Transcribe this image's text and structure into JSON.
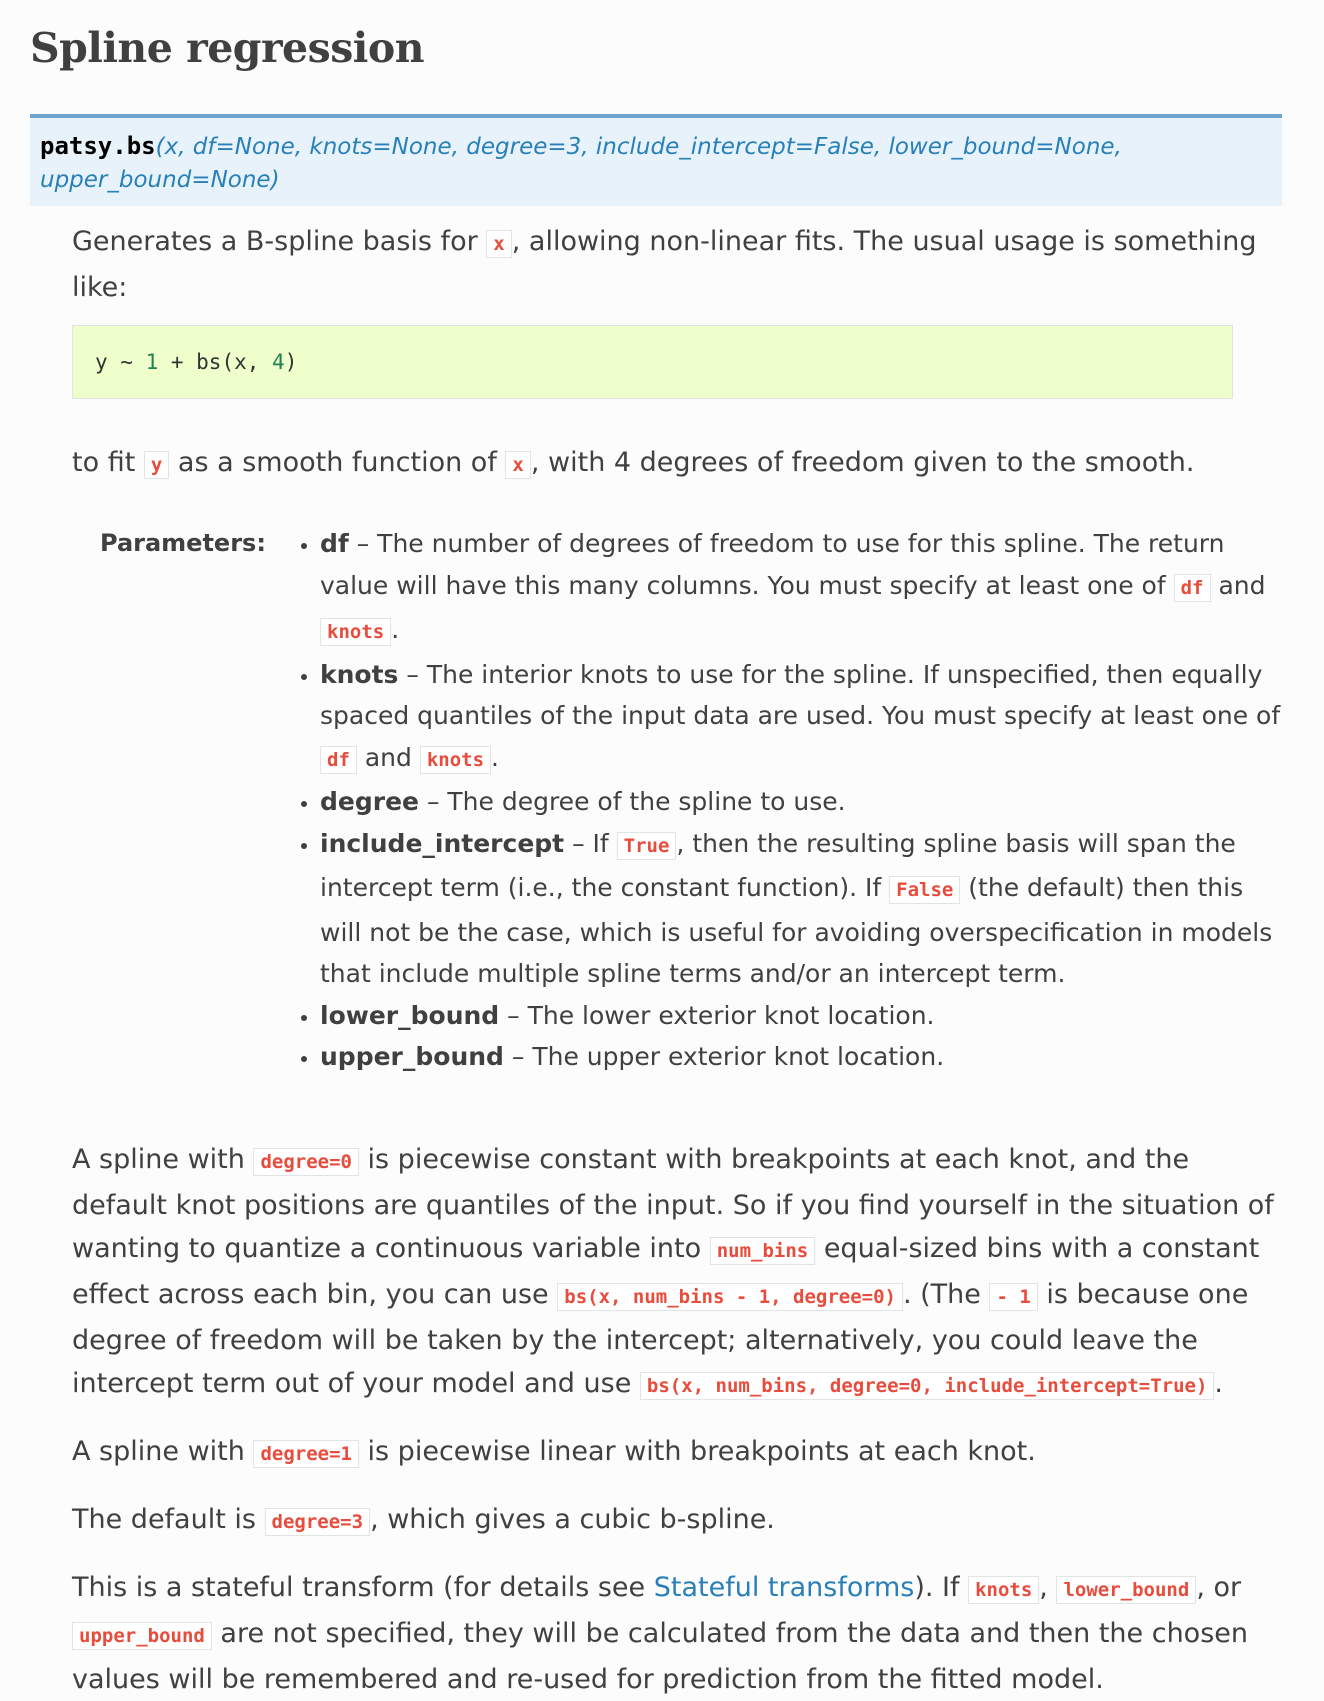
{
  "title": "Spline regression",
  "signature": {
    "name": "patsy.bs",
    "params": "(x, df=None, knots=None, degree=3, include_intercept=False, lower_bound=None, upper_bound=None)"
  },
  "intro": {
    "before": "Generates a B-spline basis for ",
    "code": "x",
    "after": ", allowing non-linear fits. The usual usage is something like:"
  },
  "example": {
    "pre": "y ~ ",
    "one": "1",
    "mid": " + bs(x, ",
    "four": "4",
    "post": ")"
  },
  "fit_sentence": {
    "a": "to fit ",
    "code_y": "y",
    "b": " as a smooth function of ",
    "code_x": "x",
    "c": ", with 4 degrees of freedom given to the smooth."
  },
  "parameters": {
    "label": "Parameters:",
    "df": {
      "name": "df",
      "t1": " – The number of degrees of freedom to use for this spline. The return value will have this many columns. You must specify at least one of ",
      "c1": "df",
      "t2": " and ",
      "c2": "knots",
      "t3": "."
    },
    "knots": {
      "name": "knots",
      "t1": " – The interior knots to use for the spline. If unspecified, then equally spaced quantiles of the input data are used. You must specify at least one of ",
      "c1": "df",
      "t2": " and ",
      "c2": "knots",
      "t3": "."
    },
    "degree": {
      "name": "degree",
      "t1": " – The degree of the spline to use."
    },
    "include_intercept": {
      "name": "include_intercept",
      "t1": " – If ",
      "c1": "True",
      "t2": ", then the resulting spline basis will span the intercept term (i.e., the constant function). If ",
      "c2": "False",
      "t3": " (the default) then this will not be the case, which is useful for avoiding overspecification in models that include multiple spline terms and/or an intercept term."
    },
    "lower_bound": {
      "name": "lower_bound",
      "t1": " – The lower exterior knot location."
    },
    "upper_bound": {
      "name": "upper_bound",
      "t1": " – The upper exterior knot location."
    }
  },
  "para_degree0": {
    "t1": "A spline with ",
    "c1": "degree=0",
    "t2": " is piecewise constant with breakpoints at each knot, and the default knot positions are quantiles of the input. So if you find yourself in the situation of wanting to quantize a continuous variable into ",
    "c2": "num_bins",
    "t3": " equal-sized bins with a constant effect across each bin, you can use ",
    "c3": "bs(x, num_bins - 1, degree=0)",
    "t4": ". (The ",
    "c4": "- 1",
    "t5": " is because one degree of freedom will be taken by the intercept; alternatively, you could leave the intercept term out of your model and use ",
    "c5": "bs(x, num_bins, degree=0, include_intercept=True)",
    "t6": "."
  },
  "para_degree1": {
    "t1": "A spline with ",
    "c1": "degree=1",
    "t2": " is piecewise linear with breakpoints at each knot."
  },
  "para_default": {
    "t1": "The default is ",
    "c1": "degree=3",
    "t2": ", which gives a cubic b-spline."
  },
  "para_stateful": {
    "t1": "This is a stateful transform (for details see ",
    "link": "Stateful transforms",
    "t2": "). If ",
    "c1": "knots",
    "t3": ", ",
    "c2": "lower_bound",
    "t4": ", or ",
    "c3": "upper_bound",
    "t5": " are not specified, they will be calculated from the data and then the chosen values will be remembered and re-used for prediction from the fitted model."
  }
}
